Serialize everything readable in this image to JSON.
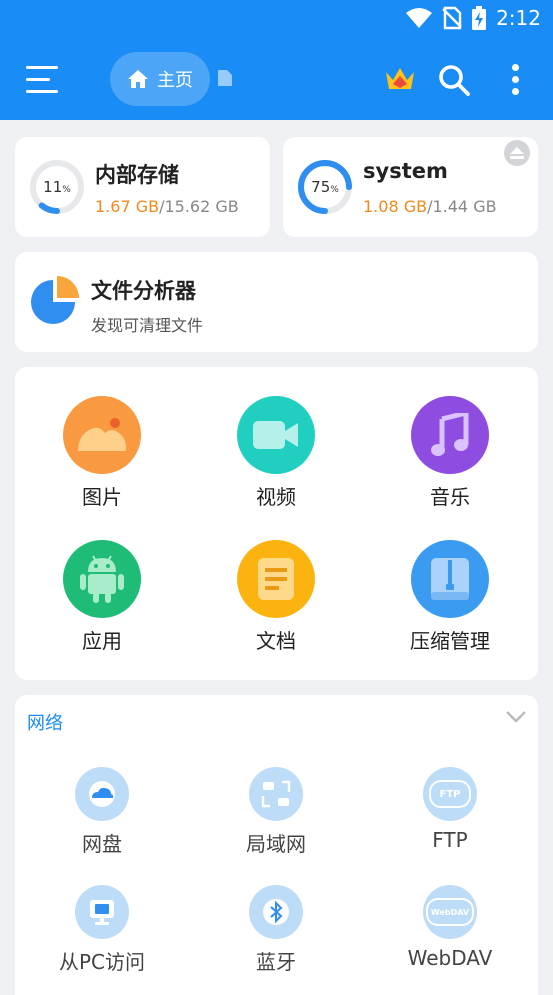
{
  "status_bar": {
    "time": "2:12"
  },
  "app_bar": {
    "home_label": "主页"
  },
  "storage": [
    {
      "percent_text": "11",
      "percent_unit": "%",
      "percent": 0.11,
      "name": "内部存储",
      "used": "1.67 GB",
      "total": "/15.62 GB"
    },
    {
      "percent_text": "75",
      "percent_unit": "%",
      "percent": 0.75,
      "name": "system",
      "used": "1.08 GB",
      "total": "/1.44 GB"
    }
  ],
  "analyzer": {
    "title": "文件分析器",
    "subtitle": "发现可清理文件"
  },
  "categories": [
    {
      "label": "图片",
      "icon": "image-icon",
      "color": "#f99a40"
    },
    {
      "label": "视频",
      "icon": "video-icon",
      "color": "#20cfc0"
    },
    {
      "label": "音乐",
      "icon": "music-icon",
      "color": "#8e4ce0"
    },
    {
      "label": "应用",
      "icon": "android-icon",
      "color": "#1fbc78"
    },
    {
      "label": "文档",
      "icon": "document-icon",
      "color": "#fbb40f"
    },
    {
      "label": "压缩管理",
      "icon": "archive-icon",
      "color": "#3b9bf0"
    }
  ],
  "network": {
    "title": "网络",
    "items": [
      {
        "label": "网盘",
        "icon": "cloud-icon"
      },
      {
        "label": "局域网",
        "icon": "lan-icon"
      },
      {
        "label": "FTP",
        "icon": "ftp-icon",
        "badge": "FTP"
      },
      {
        "label": "从PC访问",
        "icon": "pc-access-icon"
      },
      {
        "label": "蓝牙",
        "icon": "bluetooth-icon"
      },
      {
        "label": "WebDAV",
        "icon": "webdav-icon",
        "badge": "WebDAV"
      }
    ]
  },
  "colors": {
    "primary": "#1a8cf5",
    "used_text": "#f08a1c",
    "background": "#eef0f3"
  }
}
